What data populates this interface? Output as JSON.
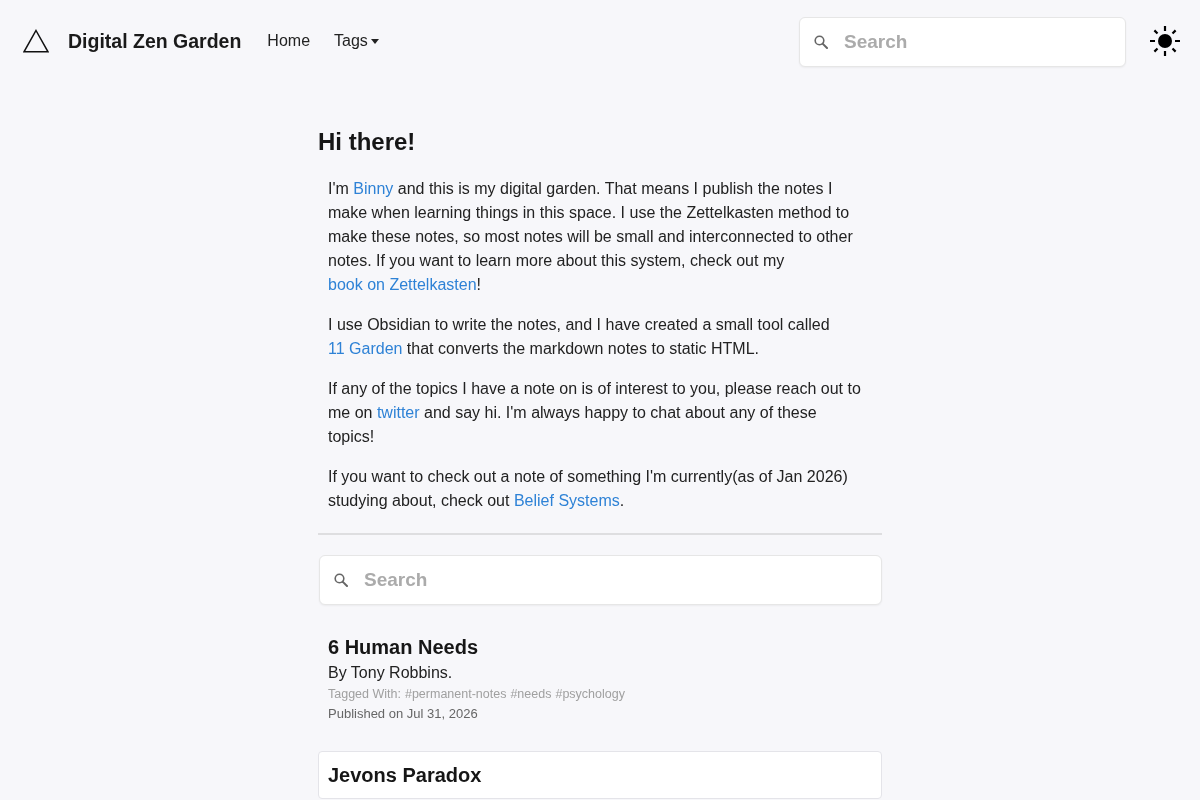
{
  "header": {
    "site_title": "Digital Zen Garden",
    "nav": [
      {
        "label": "Home",
        "kind": "link"
      },
      {
        "label": "Tags",
        "kind": "dropdown"
      }
    ],
    "search": {
      "placeholder": "Search"
    }
  },
  "intro": {
    "heading": "Hi there!",
    "paragraphs": [
      [
        {
          "kind": "text",
          "text": "I'm "
        },
        {
          "kind": "link",
          "text": "Binny"
        },
        {
          "kind": "text",
          "text": " and this is my digital garden. That means I publish the notes I make when learning things in this space. I use the Zettelkasten method to make these notes, so most notes will be small and interconnected to other notes. If you want to learn more about this system, check out my "
        },
        {
          "kind": "link",
          "text": "book on Zettelkasten"
        },
        {
          "kind": "text",
          "text": "!"
        }
      ],
      [
        {
          "kind": "text",
          "text": "I use Obsidian to write the notes, and I have created a small tool called "
        },
        {
          "kind": "link",
          "text": "11 Garden"
        },
        {
          "kind": "text",
          "text": " that converts the markdown notes to static HTML."
        }
      ],
      [
        {
          "kind": "text",
          "text": "If any of the topics I have a note on is of interest to you, please reach out to me on "
        },
        {
          "kind": "link",
          "text": "twitter"
        },
        {
          "kind": "text",
          "text": " and say hi. I'm always happy to chat about any of these topics!"
        }
      ],
      [
        {
          "kind": "text",
          "text": "If you want to check out a note of something I'm currently(as of Jan 2026) studying about, check out "
        },
        {
          "kind": "link",
          "text": "Belief Systems"
        },
        {
          "kind": "text",
          "text": "."
        }
      ]
    ]
  },
  "notes_search": {
    "placeholder": "Search"
  },
  "notes": [
    {
      "title": "6 Human Needs",
      "summary": "By Tony Robbins.",
      "tags_label": "Tagged With:",
      "tags": [
        "#permanent-notes",
        "#needs",
        "#psychology"
      ],
      "published": "Published on Jul 31, 2026",
      "highlighted": false
    },
    {
      "title": "Jevons Paradox",
      "highlighted": true
    }
  ]
}
